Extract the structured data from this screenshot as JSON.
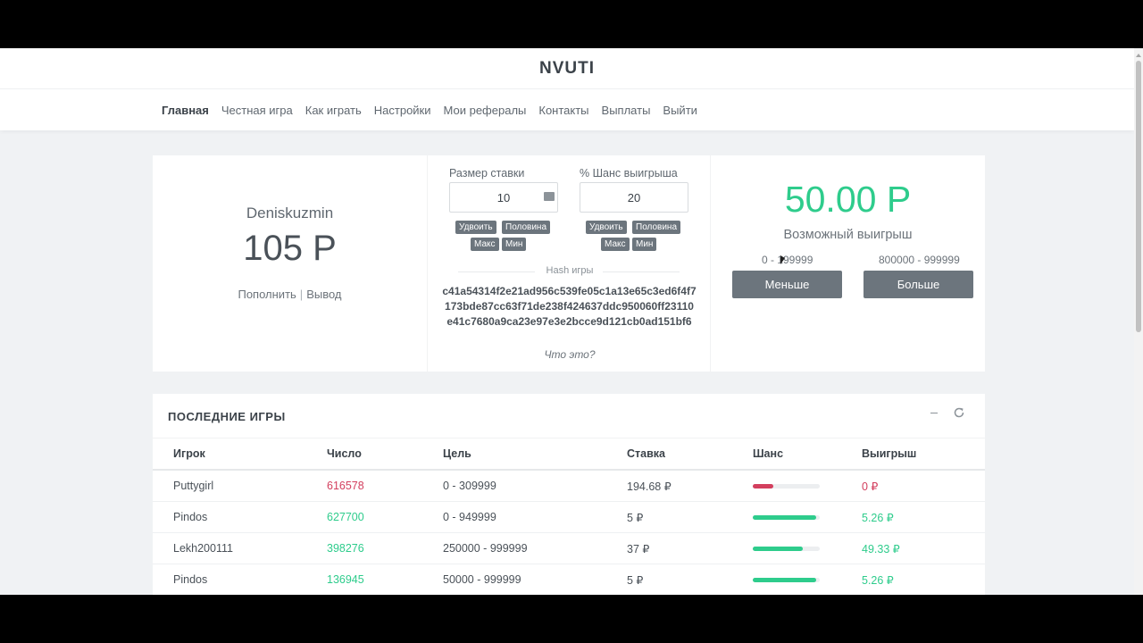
{
  "app": {
    "brand": "NVUTI",
    "nav": [
      "Главная",
      "Честная игра",
      "Как играть",
      "Настройки",
      "Мои рефералы",
      "Контакты",
      "Выплаты",
      "Выйти"
    ],
    "nav_active": "Главная"
  },
  "account": {
    "username": "Deniskuzmin",
    "balance": "105 Р",
    "deposit_label": "Пополнить",
    "separator": "|",
    "withdraw_label": "Вывод"
  },
  "bet_form": {
    "bet_label": "Размер ставки",
    "bet_value": "10",
    "chance_label": "% Шанс выигрыша",
    "chance_value": "20",
    "double_label": "Удвоить",
    "half_label": "Половина",
    "max_label": "Макс",
    "min_label": "Мин"
  },
  "hash": {
    "title": "Hash игры",
    "value": "c41a54314f2e21ad956c539fe05c1a13e65c3ed6f4f7173bde87cc63f71de238f424637ddc950060ff23110e41c7680a9ca23e97e3e2bcce9d121cb0ad151bf6",
    "help_link": "Что это?"
  },
  "play": {
    "payout": "50.00 Р",
    "payout_label": "Возможный выигрыш",
    "range_low": "0 - 199999",
    "range_high": "800000 - 999999",
    "less_button": "Меньше",
    "more_button": "Больше"
  },
  "games": {
    "title": "ПОСЛЕДНИЕ ИГРЫ",
    "columns": [
      "Игрок",
      "Число",
      "Цель",
      "Ставка",
      "Шанс",
      "Выигрыш"
    ],
    "rows": [
      {
        "player": "Puttygirl",
        "number": "616578",
        "goal": "0 - 309999",
        "bet": "194.68 ₽",
        "chance": 0.31,
        "win": "0 ₽",
        "result": "lose"
      },
      {
        "player": "Pindos",
        "number": "627700",
        "goal": "0 - 949999",
        "bet": "5 ₽",
        "chance": 0.95,
        "win": "5.26 ₽",
        "result": "win"
      },
      {
        "player": "Lekh200111",
        "number": "398276",
        "goal": "250000 - 999999",
        "bet": "37 ₽",
        "chance": 0.75,
        "win": "49.33 ₽",
        "result": "win"
      },
      {
        "player": "Pindos",
        "number": "136945",
        "goal": "50000 - 999999",
        "bet": "5 ₽",
        "chance": 0.95,
        "win": "5.26 ₽",
        "result": "win"
      }
    ]
  },
  "colors": {
    "win": "#2ecc8c",
    "lose": "#d33f5e",
    "button": "#6c757d"
  }
}
